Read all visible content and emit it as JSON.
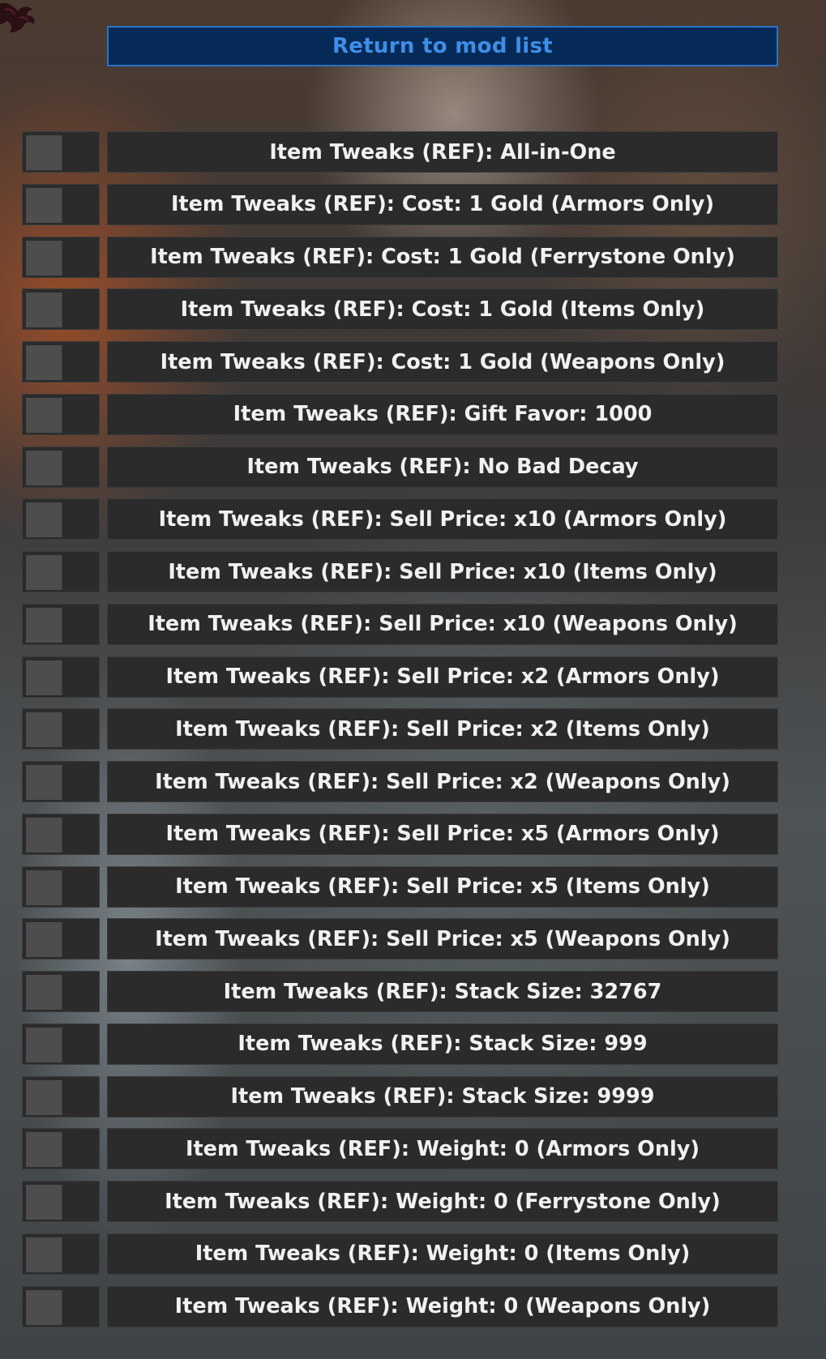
{
  "colors": {
    "button_bg": "#062a57",
    "button_border": "#2a73c8",
    "button_text": "#3e8ee8",
    "row_bg": "#2b2b2b",
    "row_text": "#f1f1f1",
    "toggle_box": "#4d4d4d"
  },
  "corner_icon": "dragon-emblem-icon",
  "return_button": {
    "label": "Return to mod list"
  },
  "mods": [
    {
      "label": "Item Tweaks (REF): All-in-One",
      "enabled": false
    },
    {
      "label": "Item Tweaks (REF): Cost: 1 Gold (Armors Only)",
      "enabled": false
    },
    {
      "label": "Item Tweaks (REF): Cost: 1 Gold (Ferrystone Only)",
      "enabled": false
    },
    {
      "label": "Item Tweaks (REF): Cost: 1 Gold (Items Only)",
      "enabled": false
    },
    {
      "label": "Item Tweaks (REF): Cost: 1 Gold (Weapons Only)",
      "enabled": false
    },
    {
      "label": "Item Tweaks (REF): Gift Favor: 1000",
      "enabled": false
    },
    {
      "label": "Item Tweaks (REF): No Bad Decay",
      "enabled": false
    },
    {
      "label": "Item Tweaks (REF): Sell Price: x10 (Armors Only)",
      "enabled": false
    },
    {
      "label": "Item Tweaks (REF): Sell Price: x10 (Items Only)",
      "enabled": false
    },
    {
      "label": "Item Tweaks (REF): Sell Price: x10 (Weapons Only)",
      "enabled": false
    },
    {
      "label": "Item Tweaks (REF): Sell Price: x2 (Armors Only)",
      "enabled": false
    },
    {
      "label": "Item Tweaks (REF): Sell Price: x2 (Items Only)",
      "enabled": false
    },
    {
      "label": "Item Tweaks (REF): Sell Price: x2 (Weapons Only)",
      "enabled": false
    },
    {
      "label": "Item Tweaks (REF): Sell Price: x5 (Armors Only)",
      "enabled": false
    },
    {
      "label": "Item Tweaks (REF): Sell Price: x5 (Items Only)",
      "enabled": false
    },
    {
      "label": "Item Tweaks (REF): Sell Price: x5 (Weapons Only)",
      "enabled": false
    },
    {
      "label": "Item Tweaks (REF): Stack Size: 32767",
      "enabled": false
    },
    {
      "label": "Item Tweaks (REF): Stack Size: 999",
      "enabled": false
    },
    {
      "label": "Item Tweaks (REF): Stack Size: 9999",
      "enabled": false
    },
    {
      "label": "Item Tweaks (REF): Weight: 0 (Armors Only)",
      "enabled": false
    },
    {
      "label": "Item Tweaks (REF): Weight: 0 (Ferrystone Only)",
      "enabled": false
    },
    {
      "label": "Item Tweaks (REF): Weight: 0 (Items Only)",
      "enabled": false
    },
    {
      "label": "Item Tweaks (REF): Weight: 0 (Weapons Only)",
      "enabled": false
    }
  ]
}
